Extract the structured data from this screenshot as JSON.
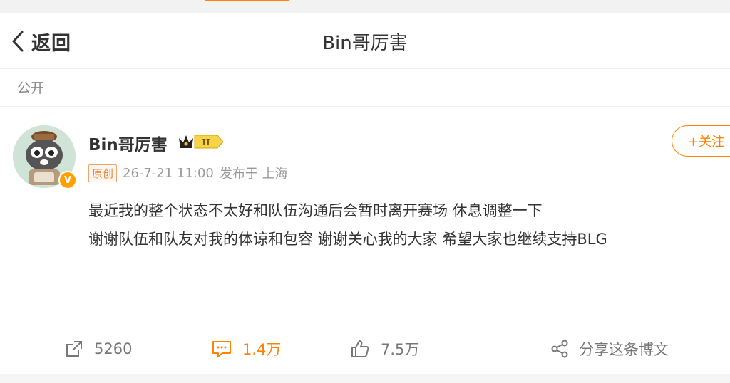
{
  "header": {
    "back_label": "返回",
    "title": "Bin哥厉害"
  },
  "visibility": "公开",
  "post": {
    "username": "Bin哥厉害",
    "level_badge": "II",
    "verified_badge": "V",
    "source_tag": "原创",
    "timestamp": "26-7-21 11:00",
    "location": "发布于 上海",
    "follow_label": "+关注",
    "lines": [
      "最近我的整个状态不太好和队伍沟通后会暂时离开赛场 休息调整一下",
      "谢谢队伍和队友对我的体谅和包容 谢谢关心我的大家 希望大家也继续支持BLG"
    ]
  },
  "actions": {
    "repost_count": "5260",
    "comment_count": "1.4万",
    "like_count": "7.5万",
    "share_label": "分享这条博文"
  },
  "colors": {
    "accent": "#ff8200",
    "text": "#333333",
    "muted": "#999999"
  },
  "icons": [
    "chevron-left-icon",
    "crown-icon",
    "verified-icon",
    "repost-icon",
    "comment-icon",
    "like-icon",
    "share-icon"
  ]
}
